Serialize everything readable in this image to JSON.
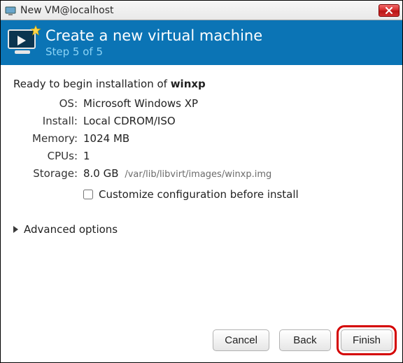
{
  "window": {
    "title": "New VM@localhost"
  },
  "header": {
    "title": "Create a new virtual machine",
    "step": "Step 5 of 5"
  },
  "body": {
    "ready_prefix": "Ready to begin installation of ",
    "vm_name": "winxp",
    "specs": {
      "os_label": "OS:",
      "os_value": "Microsoft Windows XP",
      "install_label": "Install:",
      "install_value": "Local CDROM/ISO",
      "memory_label": "Memory:",
      "memory_value": "1024 MB",
      "cpus_label": "CPUs:",
      "cpus_value": "1",
      "storage_label": "Storage:",
      "storage_value": "8.0 GB",
      "storage_path": "/var/lib/libvirt/images/winxp.img"
    },
    "customize_label": "Customize configuration before install",
    "advanced_label": "Advanced options"
  },
  "footer": {
    "cancel": "Cancel",
    "back": "Back",
    "finish": "Finish"
  }
}
